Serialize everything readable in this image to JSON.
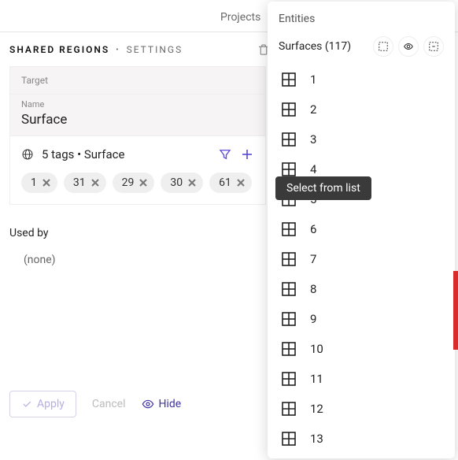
{
  "top_tab": "Projects",
  "breadcrumb": {
    "region": "SHARED REGIONS",
    "settings": "SETTINGS"
  },
  "target_label": "Target",
  "name_field": {
    "label": "Name",
    "value": "Surface"
  },
  "tags_summary": "5 tags • Surface",
  "tags": [
    "1",
    "31",
    "29",
    "30",
    "61"
  ],
  "used_by": {
    "label": "Used by",
    "none": "(none)"
  },
  "buttons": {
    "apply": "Apply",
    "cancel": "Cancel",
    "hide": "Hide"
  },
  "panel": {
    "title": "Entities",
    "subtitle_prefix": "Surfaces",
    "count": 117,
    "items": [
      "1",
      "2",
      "3",
      "4",
      "5",
      "6",
      "7",
      "8",
      "9",
      "10",
      "11",
      "12",
      "13"
    ]
  },
  "tooltip": "Select from list"
}
